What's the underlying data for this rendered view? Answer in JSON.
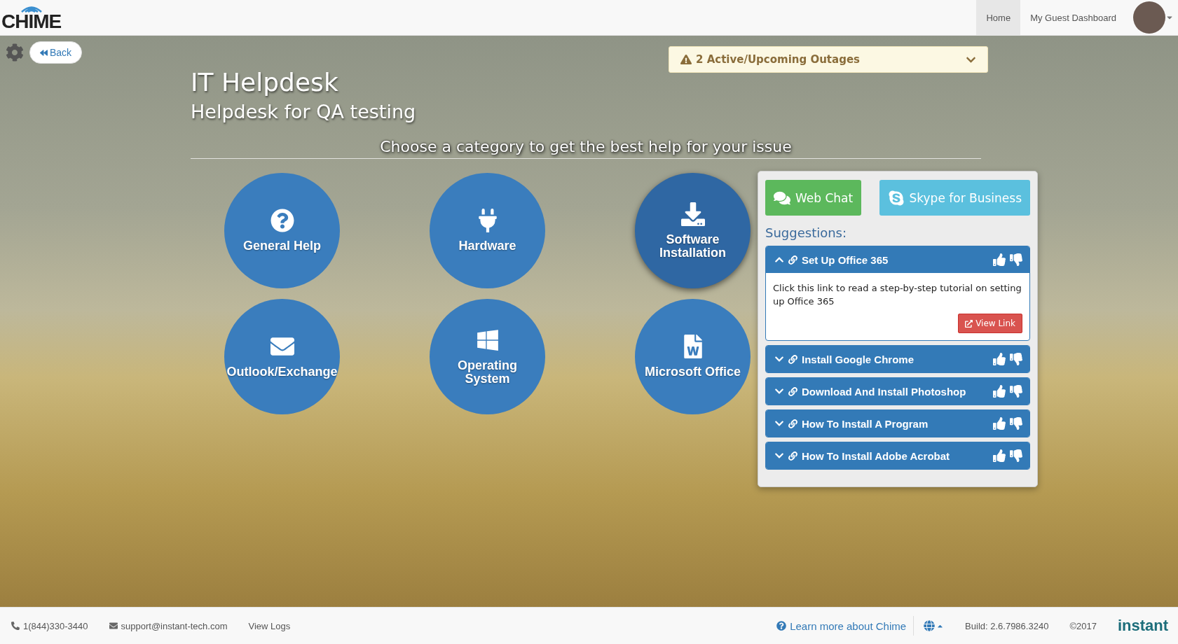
{
  "header": {
    "logo": "CHIME",
    "nav": [
      {
        "label": "Home",
        "selected": true
      },
      {
        "label": "My Guest Dashboard",
        "selected": false
      }
    ]
  },
  "toolbar": {
    "back": "Back"
  },
  "outages": {
    "label": "2 Active/Upcoming Outages",
    "expanded": false
  },
  "title": "IT Helpdesk",
  "subtitle": "Helpdesk for QA testing",
  "prompt": "Choose a category to get the best help for your issue",
  "categories": [
    {
      "label": "General Help",
      "selected": false
    },
    {
      "label": "Hardware",
      "selected": false
    },
    {
      "label": "Software Installation",
      "selected": true
    },
    {
      "label": "Outlook/Exchange",
      "selected": false
    },
    {
      "label": "Operating System",
      "selected": false
    },
    {
      "label": "Microsoft Office",
      "selected": false
    }
  ],
  "contact": [
    {
      "label": "Web Chat",
      "kind": "chat"
    },
    {
      "label": "Skype for Business",
      "kind": "skype"
    }
  ],
  "suggestions_heading": "Suggestions:",
  "suggestions": [
    {
      "title": "Set Up Office 365",
      "expanded": true,
      "body": "Click this link to read a step-by-step tutorial on setting up Office 365",
      "link": "View Link"
    },
    {
      "title": "Install Google Chrome",
      "expanded": false
    },
    {
      "title": "Download And Install Photoshop",
      "expanded": false
    },
    {
      "title": "How To Install A Program",
      "expanded": false
    },
    {
      "title": "How To Install Adobe Acrobat",
      "expanded": false
    }
  ],
  "footer": {
    "phone": "1(844)330-3440",
    "email": "support@instant-tech.com",
    "logs": "View Logs",
    "learn": "Learn more about Chime",
    "build": "Build: 2.6.7986.3240",
    "copyright": "©2017",
    "brand": "instant"
  }
}
